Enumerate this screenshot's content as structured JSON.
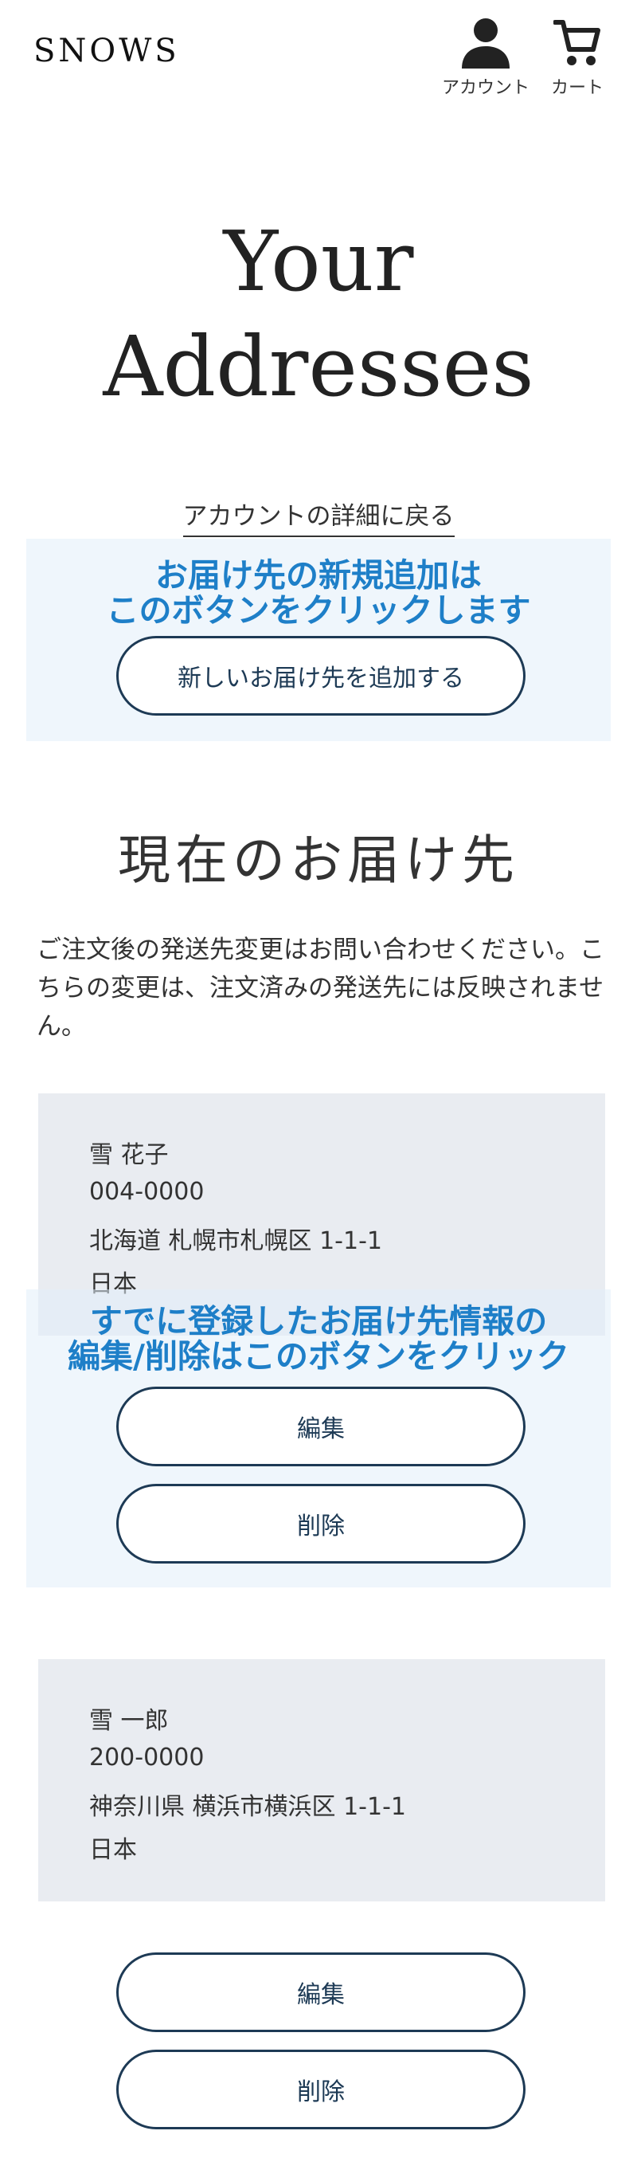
{
  "header": {
    "logo": "SNOWS",
    "account_label": "アカウント",
    "cart_label": "カート"
  },
  "page": {
    "title_line1": "Your",
    "title_line2": "Addresses",
    "back_link": "アカウントの詳細に戻る"
  },
  "hints": {
    "add_line1": "お届け先の新規追加は",
    "add_line2": "このボタンをクリックします",
    "edit_line1": "すでに登録したお届け先情報の",
    "edit_line2": "編集/削除はこのボタンをクリック"
  },
  "add_button": "新しいお届け先を追加する",
  "section": {
    "title": "現在のお届け先",
    "notice": "ご注文後の発送先変更はお問い合わせください。こちらの変更は、注文済みの発送先には反映されません。"
  },
  "addresses": [
    {
      "name": "雪 花子",
      "postal": "004-0000",
      "address": "北海道 札幌市札幌区 1-1-1",
      "country": "日本",
      "edit_label": "編集",
      "delete_label": "削除"
    },
    {
      "name": "雪 一郎",
      "postal": "200-0000",
      "address": "神奈川県 横浜市横浜区 1-1-1",
      "country": "日本",
      "edit_label": "編集",
      "delete_label": "削除"
    }
  ],
  "colors": {
    "accent": "#1d3a55",
    "hint_text": "#1e7fc8",
    "card_bg": "#e9ecf1"
  }
}
